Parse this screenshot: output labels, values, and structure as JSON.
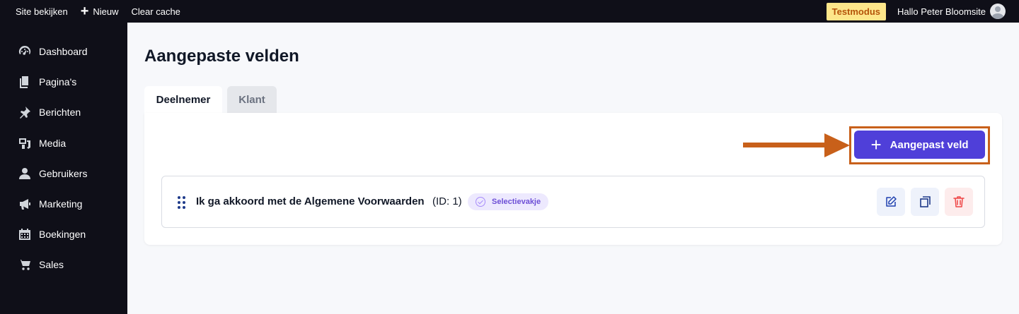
{
  "topbar": {
    "view_site": "Site bekijken",
    "new_label": "Nieuw",
    "clear_cache": "Clear cache",
    "mode_badge": "Testmodus",
    "greeting": "Hallo Peter Bloomsite"
  },
  "sidebar": {
    "items": [
      {
        "label": "Dashboard",
        "icon": "dashboard-icon"
      },
      {
        "label": "Pagina's",
        "icon": "pages-icon"
      },
      {
        "label": "Berichten",
        "icon": "pin-icon"
      },
      {
        "label": "Media",
        "icon": "media-icon"
      },
      {
        "label": "Gebruikers",
        "icon": "user-icon"
      },
      {
        "label": "Marketing",
        "icon": "megaphone-icon"
      },
      {
        "label": "Boekingen",
        "icon": "calendar-icon"
      },
      {
        "label": "Sales",
        "icon": "cart-icon"
      }
    ]
  },
  "main": {
    "title": "Aangepaste velden",
    "tabs": [
      {
        "label": "Deelnemer",
        "active": true
      },
      {
        "label": "Klant",
        "active": false
      }
    ],
    "add_button_label": "Aangepast veld",
    "fields": [
      {
        "name": "Ik ga akkoord met de Algemene Voorwaarden",
        "id_text": "(ID: 1)",
        "type": "Selectievakje"
      }
    ]
  },
  "colors": {
    "accent": "#4f3fd9",
    "annotation": "#c8601a",
    "sidebar_bg": "#0f0f18",
    "badge_bg": "#fde68a"
  }
}
